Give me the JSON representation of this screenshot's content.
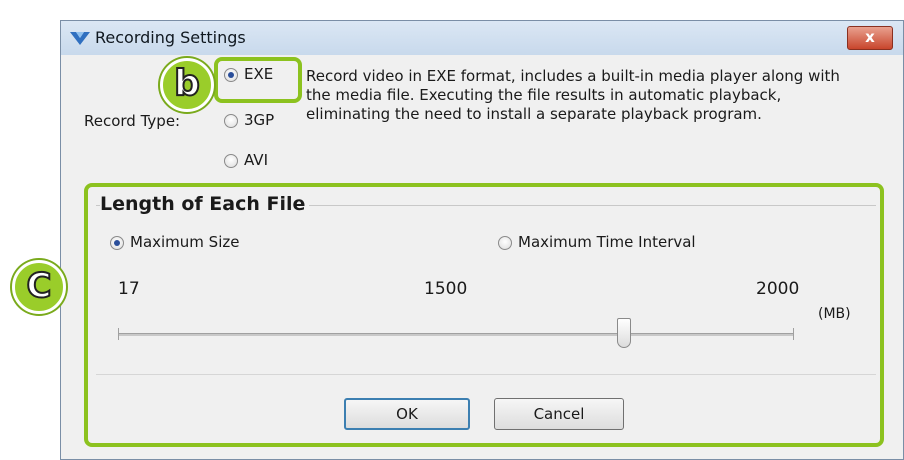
{
  "window": {
    "title": "Recording Settings",
    "close_label": "x"
  },
  "record_type": {
    "label": "Record Type:",
    "options": [
      {
        "label": "EXE",
        "checked": true
      },
      {
        "label": "3GP",
        "checked": false
      },
      {
        "label": "AVI",
        "checked": false
      }
    ],
    "description": "Record video in EXE format, includes a built-in media player along with the media file. Executing the file results in automatic playback, eliminating the need to install a separate playback program."
  },
  "length_group": {
    "title": "Length of Each File",
    "options": [
      {
        "label": "Maximum Size",
        "checked": true
      },
      {
        "label": "Maximum Time Interval",
        "checked": false
      }
    ],
    "slider": {
      "min_label": "17",
      "value_label": "1500",
      "max_label": "2000",
      "unit": "(MB)",
      "min": 17,
      "value": 1500,
      "max": 2000
    }
  },
  "buttons": {
    "ok": "OK",
    "cancel": "Cancel"
  },
  "callouts": {
    "b": "b",
    "c": "C"
  },
  "colors": {
    "callout_green": "#8cc21f",
    "title_bar": "#c8d9ec",
    "dialog_bg": "#f0f0f0"
  }
}
